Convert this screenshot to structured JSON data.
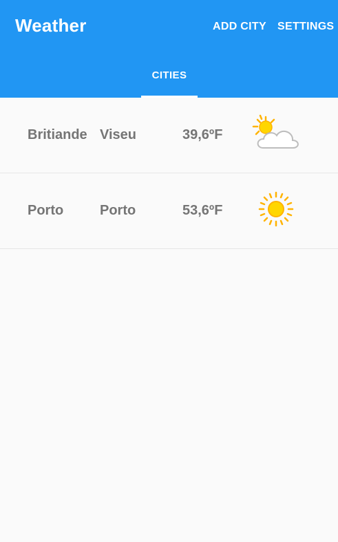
{
  "app": {
    "title": "Weather",
    "actions": {
      "add_city": "ADD CITY",
      "settings": "SETTINGS"
    },
    "tabs": [
      {
        "label": "CITIES",
        "selected": true
      }
    ]
  },
  "cities": [
    {
      "city": "Britiande",
      "region": "Viseu",
      "temperature": "39,6ºF",
      "icon": "partly-cloudy-icon"
    },
    {
      "city": "Porto",
      "region": "Porto",
      "temperature": "53,6ºF",
      "icon": "sunny-icon"
    }
  ],
  "colors": {
    "primary": "#2196f3",
    "background": "#fafafa",
    "text_secondary": "#757575",
    "sun": "#ffd600",
    "sun_rays": "#ffb300"
  }
}
